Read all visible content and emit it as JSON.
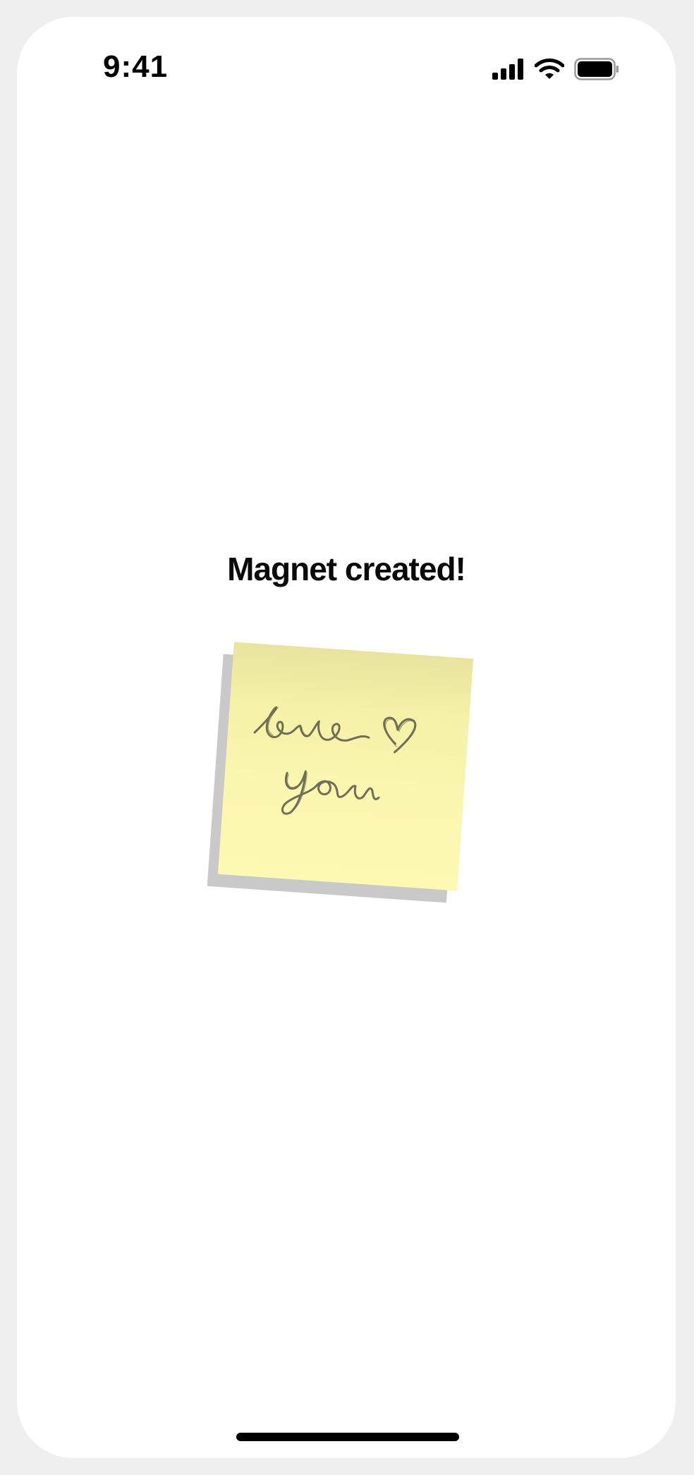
{
  "status_bar": {
    "time": "9:41",
    "icons": [
      "cellular-signal-icon",
      "wifi-icon",
      "battery-icon"
    ]
  },
  "main": {
    "title": "Magnet created!",
    "sticky_note": {
      "color": "#fbf6b0",
      "handwritten_text": "love you"
    }
  },
  "colors": {
    "background": "#ffffff",
    "frame": "#efefef",
    "note": "#fbf6b0",
    "ink": "#6f6f55",
    "text": "#0a0a0a"
  }
}
